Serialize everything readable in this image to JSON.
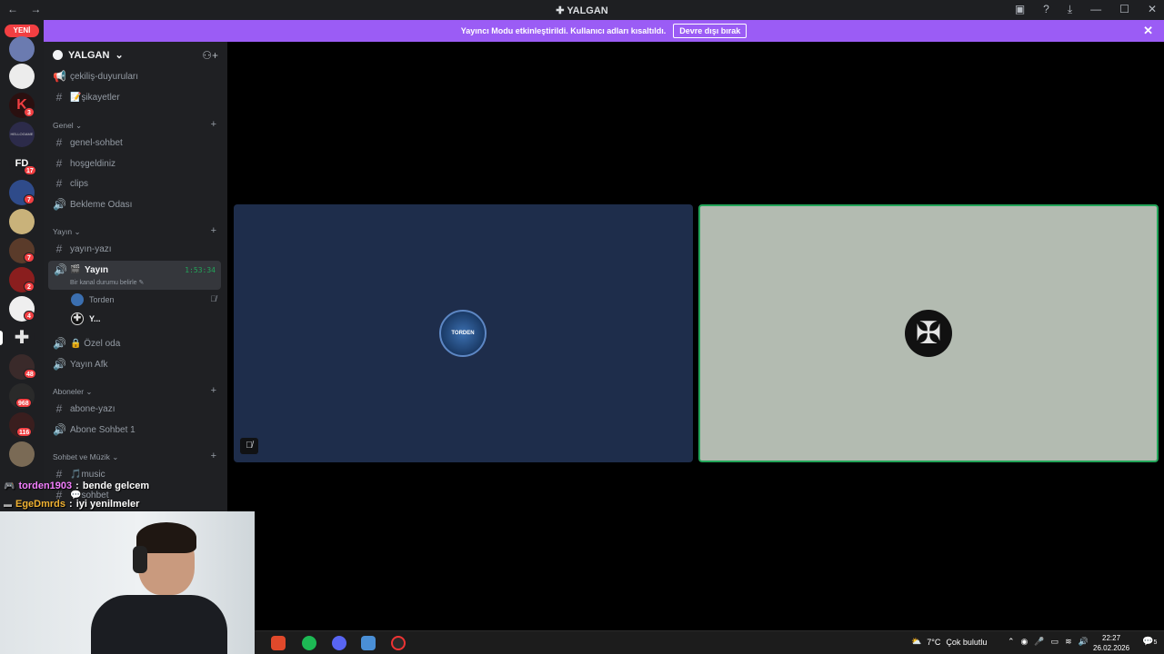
{
  "window": {
    "title": "YALGAN"
  },
  "banner": {
    "text": "Yayıncı Modu etkinleştirildi. Kullanıcı adları kısaltıldı.",
    "button_label": "Devre dışı bırak"
  },
  "server_rail": {
    "new_badge": "YENİ",
    "badges": [
      "3",
      "17",
      "7",
      "7",
      "2",
      "4",
      "48",
      "968",
      "116"
    ],
    "label_fd": "FD",
    "label_hellogame": "HELLOGAME"
  },
  "server": {
    "name": "YALGAN"
  },
  "channels": {
    "top": [
      {
        "label": "çekiliş-duyuruları",
        "type": "announcement"
      },
      {
        "label": "📝şikayetler",
        "type": "text"
      }
    ],
    "categories": [
      {
        "name": "Genel",
        "channels": [
          {
            "label": "genel-sohbet",
            "type": "text"
          },
          {
            "label": "hoşgeldiniz",
            "type": "text"
          },
          {
            "label": "clips",
            "type": "text"
          },
          {
            "label": "Bekleme Odası",
            "type": "voice"
          }
        ]
      },
      {
        "name": "Yayın",
        "channels": [
          {
            "label": "yayın-yazı",
            "type": "text"
          }
        ]
      },
      {
        "name": "Aboneler",
        "channels": [
          {
            "label": "abone-yazı",
            "type": "text"
          },
          {
            "label": "Abone Sohbet 1",
            "type": "voice"
          }
        ]
      },
      {
        "name": "Sohbet ve Müzik",
        "channels": [
          {
            "label": "🎵music",
            "type": "text"
          },
          {
            "label": "💬sohbet",
            "type": "text"
          }
        ]
      }
    ],
    "active_voice": {
      "name": "Yayın",
      "status_hint": "Bir kanal durumu belirle",
      "timer": "1:53:34",
      "members": [
        {
          "name": "Torden"
        },
        {
          "name": "Y..."
        }
      ]
    },
    "after_active": [
      {
        "label": "🔒 Özel oda",
        "type": "voice"
      },
      {
        "label": "Yayın Afk",
        "type": "voice"
      }
    ]
  },
  "tiles": {
    "left_avatar_text": "TORDEN"
  },
  "chat_overlay": [
    {
      "user": "torden1903",
      "message": "bende gelcem",
      "color": "#f47fff"
    },
    {
      "user": "EgeDmrds",
      "message": "iyi yenilmeler",
      "color": "#f0b232"
    }
  ],
  "taskbar": {
    "weather_temp": "7°C",
    "weather_desc": "Çok bulutlu",
    "time": "22:27",
    "date": "26.02.2026",
    "notif_count": "5"
  },
  "colors": {
    "accent_purple": "#9b5cf5",
    "speaking_green": "#23a55a",
    "badge_red": "#f23f42"
  }
}
